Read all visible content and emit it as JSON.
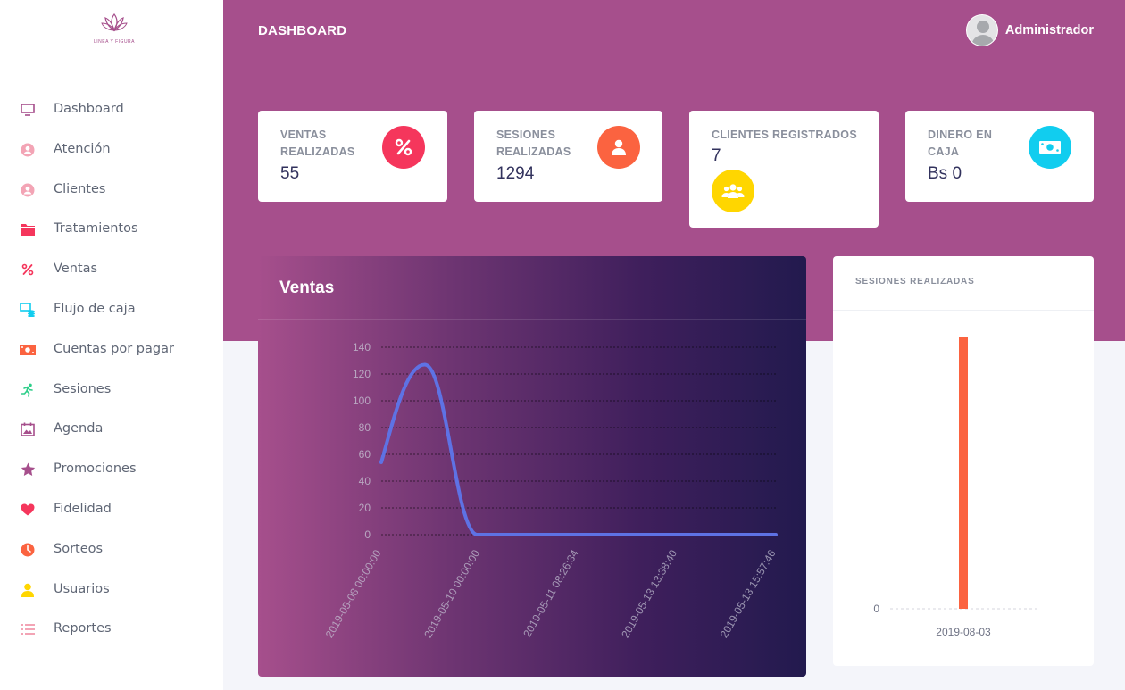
{
  "app": {
    "logo_text": "LINEA Y FIGURA"
  },
  "sidebar": {
    "items": [
      {
        "label": "Dashboard",
        "icon": "monitor-icon",
        "color": "#a64f8c"
      },
      {
        "label": "Atención",
        "icon": "user-circle-icon",
        "color": "#f3a4b5"
      },
      {
        "label": "Clientes",
        "icon": "user-circle-icon",
        "color": "#f3a4b5"
      },
      {
        "label": "Tratamientos",
        "icon": "folder-icon",
        "color": "#f5365c"
      },
      {
        "label": "Ventas",
        "icon": "percent-icon",
        "color": "#f5365c"
      },
      {
        "label": "Flujo de caja",
        "icon": "cash-flow-icon",
        "color": "#11cdef"
      },
      {
        "label": "Cuentas por pagar",
        "icon": "money-icon",
        "color": "#fb6340"
      },
      {
        "label": "Sesiones",
        "icon": "running-icon",
        "color": "#2dce89"
      },
      {
        "label": "Agenda",
        "icon": "calendar-icon",
        "color": "#a64f8c"
      },
      {
        "label": "Promociones",
        "icon": "star-icon",
        "color": "#a64f8c"
      },
      {
        "label": "Fidelidad",
        "icon": "heart-icon",
        "color": "#f5365c"
      },
      {
        "label": "Sorteos",
        "icon": "clock-icon",
        "color": "#fb6340"
      },
      {
        "label": "Usuarios",
        "icon": "user-icon",
        "color": "#ffd600"
      },
      {
        "label": "Reportes",
        "icon": "list-icon",
        "color": "#f3a4b5"
      }
    ]
  },
  "header": {
    "title": "DASHBOARD",
    "user_name": "Administrador"
  },
  "stats": [
    {
      "title_lines": [
        "VENTAS",
        "REALIZADAS"
      ],
      "value": "55",
      "icon": "percent-icon",
      "color": "#f5365c"
    },
    {
      "title_lines": [
        "SESIONES",
        "REALIZADAS"
      ],
      "value": "1294",
      "icon": "user-icon",
      "color": "#fb6340"
    },
    {
      "title_lines": [
        "CLIENTES REGISTRADOS"
      ],
      "value": "7",
      "icon": "users-icon",
      "color": "#ffd600"
    },
    {
      "title_lines": [
        "DINERO EN",
        "CAJA"
      ],
      "value": "Bs 0",
      "icon": "money-icon",
      "color": "#11cdef"
    }
  ],
  "charts": {
    "ventas_title": "Ventas",
    "sesiones_title": "SESIONES REALIZADAS"
  },
  "chart_data": [
    {
      "type": "line",
      "title": "Ventas",
      "x": [
        "2019-05-08 00:00:00",
        "2019-05-10 00:00:00",
        "2019-05-11 08:26:34",
        "2019-05-13 13:38:40",
        "2019-05-13 15:57:46"
      ],
      "values": [
        54,
        0,
        0,
        0,
        0
      ],
      "peak": {
        "x_between": [
          "2019-05-08 00:00:00",
          "2019-05-10 00:00:00"
        ],
        "y": 127
      },
      "yticks": [
        0,
        20,
        40,
        60,
        80,
        100,
        120,
        140
      ],
      "ylim": [
        0,
        140
      ],
      "grid": true,
      "line_color": "#5e72e4"
    },
    {
      "type": "bar",
      "title": "SESIONES REALIZADAS",
      "categories": [
        "2019-08-03"
      ],
      "values": [
        1294
      ],
      "yticks_shown": [
        0
      ],
      "bar_color": "#fb6340"
    }
  ]
}
